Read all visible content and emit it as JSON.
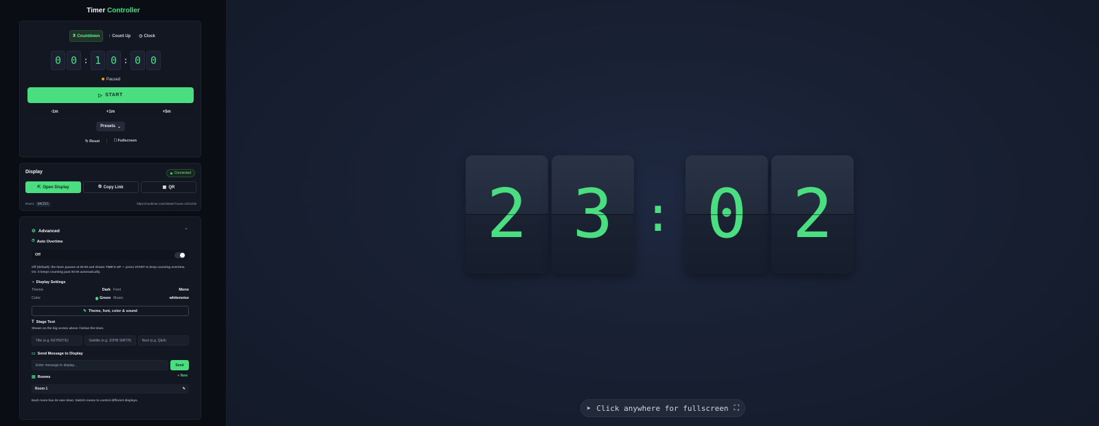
{
  "brand": {
    "part1": "Timer",
    "part2": "Controller"
  },
  "timer": {
    "modes": [
      {
        "label": "Countdown",
        "active": true,
        "icon": "hourglass-icon"
      },
      {
        "label": "Count Up",
        "active": false,
        "icon": "arrow-up-icon"
      },
      {
        "label": "Clock",
        "active": false,
        "icon": "clock-icon"
      }
    ],
    "digits": [
      "0",
      "0",
      "1",
      "0",
      "0",
      "0"
    ],
    "status": "Paused",
    "start_label": "START",
    "adjust": [
      "-1m",
      "+1m",
      "+5m"
    ],
    "presets_label": "Presets",
    "reset_label": "Reset",
    "fullscreen_label": "Fullscreen"
  },
  "display": {
    "title": "Display",
    "status": "Connected",
    "open_label": "Open Display",
    "copy_label": "Copy Link",
    "qr_label": "QR",
    "room_label": "Room:",
    "room_code": "XXCZ15",
    "url": "https://cuetimer.com/viewer?room=XXCZ15"
  },
  "advanced": {
    "title": "Advanced",
    "auto_overtime": {
      "title": "Auto Overtime",
      "state": "Off",
      "help": "Off (default): the timer pauses at 00:00 and shows TIME'S UP — press START to keep counting overtime. On: it keeps counting past 00:00 automatically."
    },
    "display_settings": {
      "title": "Display Settings",
      "theme_label": "Theme",
      "theme_value": "Dark",
      "font_label": "Font",
      "font_value": "Mono",
      "color_label": "Color",
      "color_value": "Green",
      "music_label": "Music",
      "music_value": "whitenoise",
      "button_label": "Theme, font, color & sound"
    },
    "stage_text": {
      "title": "Stage Text",
      "help": "Shown on the big screen above / below the timer.",
      "title_placeholder": "Title (e.g. KEYNOTE)",
      "subtitle_placeholder": "Subtitle (e.g. JOHN SMITH)",
      "next_placeholder": "Next (e.g. Q&A)"
    },
    "message": {
      "title": "Send Message to Display",
      "placeholder": "Enter message to display...",
      "send_label": "Send"
    },
    "rooms": {
      "title": "Rooms",
      "new_label": "+ New",
      "items": [
        {
          "name": "Room 1"
        }
      ],
      "help": "Each room has its own timer. Switch rooms to control different displays."
    }
  },
  "main_display": {
    "digits": [
      "2",
      "3",
      "0",
      "2"
    ],
    "hint": "Click anywhere for fullscreen"
  },
  "colors": {
    "accent": "#4ade80",
    "background": "#182033",
    "paused": "#f59e0b"
  }
}
